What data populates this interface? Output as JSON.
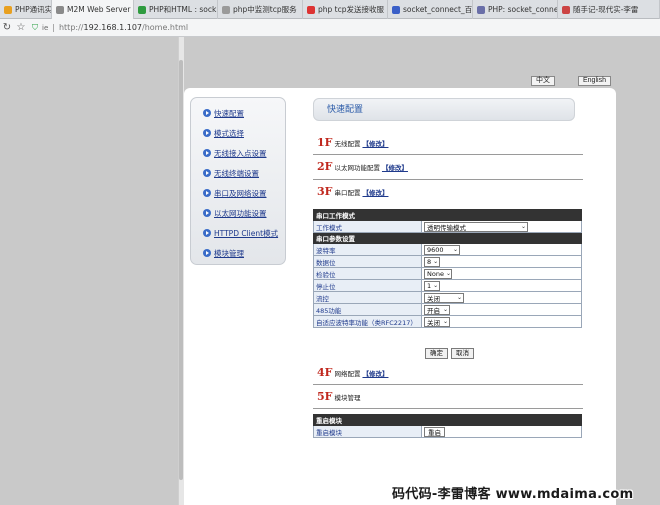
{
  "browser": {
    "tabs": [
      {
        "label": "PHP通讯实例",
        "icon_color": "#e8a020",
        "active": false
      },
      {
        "label": "M2M Web Server",
        "icon_color": "#8a8a8a",
        "active": true
      },
      {
        "label": "PHP和HTML : sock",
        "icon_color": "#2e9b3f",
        "active": false
      },
      {
        "label": "php中监测tcp服务",
        "icon_color": "#9a9a9a",
        "active": false
      },
      {
        "label": "php tcp发送接收服",
        "icon_color": "#d33",
        "active": false
      },
      {
        "label": "socket_connect_百",
        "icon_color": "#3a5fc8",
        "active": false
      },
      {
        "label": "PHP: socket_connec",
        "icon_color": "#6a6fa8",
        "active": false
      },
      {
        "label": "随手记-现代实-李雷",
        "icon_color": "#c44",
        "active": false
      }
    ],
    "close_glyph": "×",
    "address": {
      "prefix": "http://",
      "host": "192.168.1.107",
      "path": "/home.html",
      "badge": "ie"
    }
  },
  "lang": {
    "zh": "中文",
    "en": "English"
  },
  "sidebar": {
    "items": [
      {
        "label": "快速配置"
      },
      {
        "label": "模式选择"
      },
      {
        "label": "无线接入点设置"
      },
      {
        "label": "无线终端设置"
      },
      {
        "label": "串口及网络设置"
      },
      {
        "label": "以太网功能设置"
      },
      {
        "label": "HTTPD Client模式"
      },
      {
        "label": "模块管理"
      }
    ]
  },
  "main": {
    "title": "快速配置",
    "edit_label": "【修改】",
    "sections": [
      {
        "num": "1F",
        "label": "无线配置"
      },
      {
        "num": "2F",
        "label": "以太网功能配置"
      },
      {
        "num": "3F",
        "label": "串口配置"
      },
      {
        "num": "4F",
        "label": "网络配置"
      },
      {
        "num": "5F",
        "label": "模块管理"
      }
    ]
  },
  "serial": {
    "mode_header": "串口工作模式",
    "mode_label": "工作模式",
    "mode_value": "透明传输模式",
    "params_header": "串口参数设置",
    "rows": [
      {
        "label": "波特率",
        "value": "9600"
      },
      {
        "label": "数据位",
        "value": "8"
      },
      {
        "label": "检验位",
        "value": "None"
      },
      {
        "label": "停止位",
        "value": "1"
      },
      {
        "label": "流控",
        "value": "关闭"
      },
      {
        "label": "485功能",
        "value": "开启"
      },
      {
        "label": "自适应波特率功能（类RFC2217）",
        "value": "关闭"
      }
    ],
    "ok_label": "确定",
    "cancel_label": "取消"
  },
  "restart": {
    "header": "重启模块",
    "label": "重启模块",
    "button": "重启"
  },
  "watermark": "码代码-李雷博客 www.mdaima.com"
}
